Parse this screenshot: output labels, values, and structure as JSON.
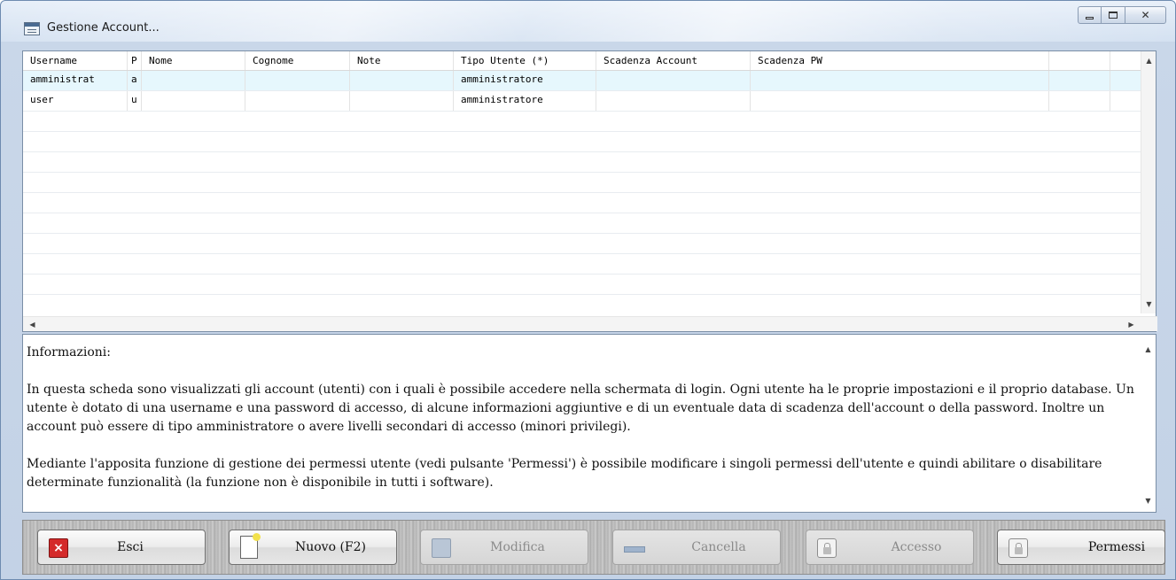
{
  "window": {
    "title": "Gestione Account...",
    "controls": {
      "minimize": "minimize-icon",
      "maximize": "maximize-icon",
      "close_glyph": "✕"
    }
  },
  "grid": {
    "columns": [
      "Username",
      "P",
      "Nome",
      "Cognome",
      "Note",
      "Tipo Utente (*)",
      "Scadenza Account",
      "Scadenza PW",
      "",
      ""
    ],
    "rows": [
      {
        "username": "amministrat",
        "p": "a",
        "nome": "",
        "cognome": "",
        "note": "",
        "tipo": "amministratore",
        "scad_account": "",
        "scad_pw": "",
        "selected": true
      },
      {
        "username": "user",
        "p": "u",
        "nome": "",
        "cognome": "",
        "note": "",
        "tipo": "amministratore",
        "scad_account": "",
        "scad_pw": "",
        "selected": false
      }
    ]
  },
  "info": {
    "heading": "Informazioni:",
    "paragraph1": "In questa scheda sono visualizzati gli account (utenti) con i quali è possibile accedere nella schermata di login. Ogni utente ha le proprie impostazioni e il proprio database. Un utente è dotato di una username e una password di accesso, di alcune informazioni aggiuntive e di un eventuale data di scadenza dell'account o della password. Inoltre un account può essere di tipo amministratore o avere livelli secondari di accesso (minori privilegi).",
    "paragraph2": "Mediante l'apposita funzione di gestione dei permessi utente (vedi pulsante 'Permessi') è possibile modificare i singoli permessi dell'utente e quindi abilitare o disabilitare determinate funzionalità (la funzione non è disponibile in tutti i software)."
  },
  "buttons": {
    "exit": {
      "label": "Esci",
      "icon": "close-red-icon",
      "enabled": true
    },
    "new": {
      "label": "Nuovo (F2)",
      "icon": "new-document-icon",
      "enabled": true
    },
    "edit": {
      "label": "Modifica",
      "icon": "edit-icon",
      "enabled": false
    },
    "delete": {
      "label": "Cancella",
      "icon": "minus-icon",
      "enabled": false
    },
    "access": {
      "label": "Accesso",
      "icon": "lock-icon",
      "enabled": false
    },
    "permissions": {
      "label": "Permessi",
      "icon": "lock-icon",
      "enabled": true
    }
  },
  "colors": {
    "selected_row": "#e6f7fd",
    "exit_icon": "#d42a2a"
  }
}
